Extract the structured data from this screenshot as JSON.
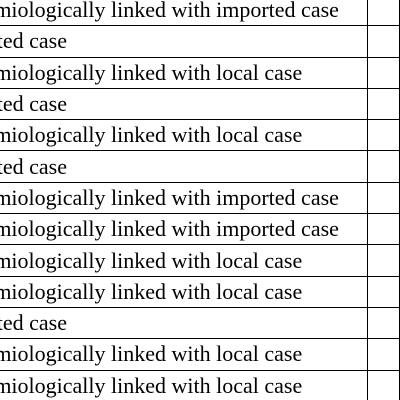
{
  "table": {
    "rows": [
      "Epidemiologically linked with imported case",
      "Imported case",
      "Epidemiologically linked with local case",
      "Imported case",
      "Epidemiologically linked with local case",
      "Imported case",
      "Epidemiologically linked with imported case",
      "Epidemiologically linked with imported case",
      "Epidemiologically linked with local case",
      "Epidemiologically linked with local case",
      "Imported case",
      "Epidemiologically linked with local case",
      "Epidemiologically linked with local case"
    ]
  }
}
